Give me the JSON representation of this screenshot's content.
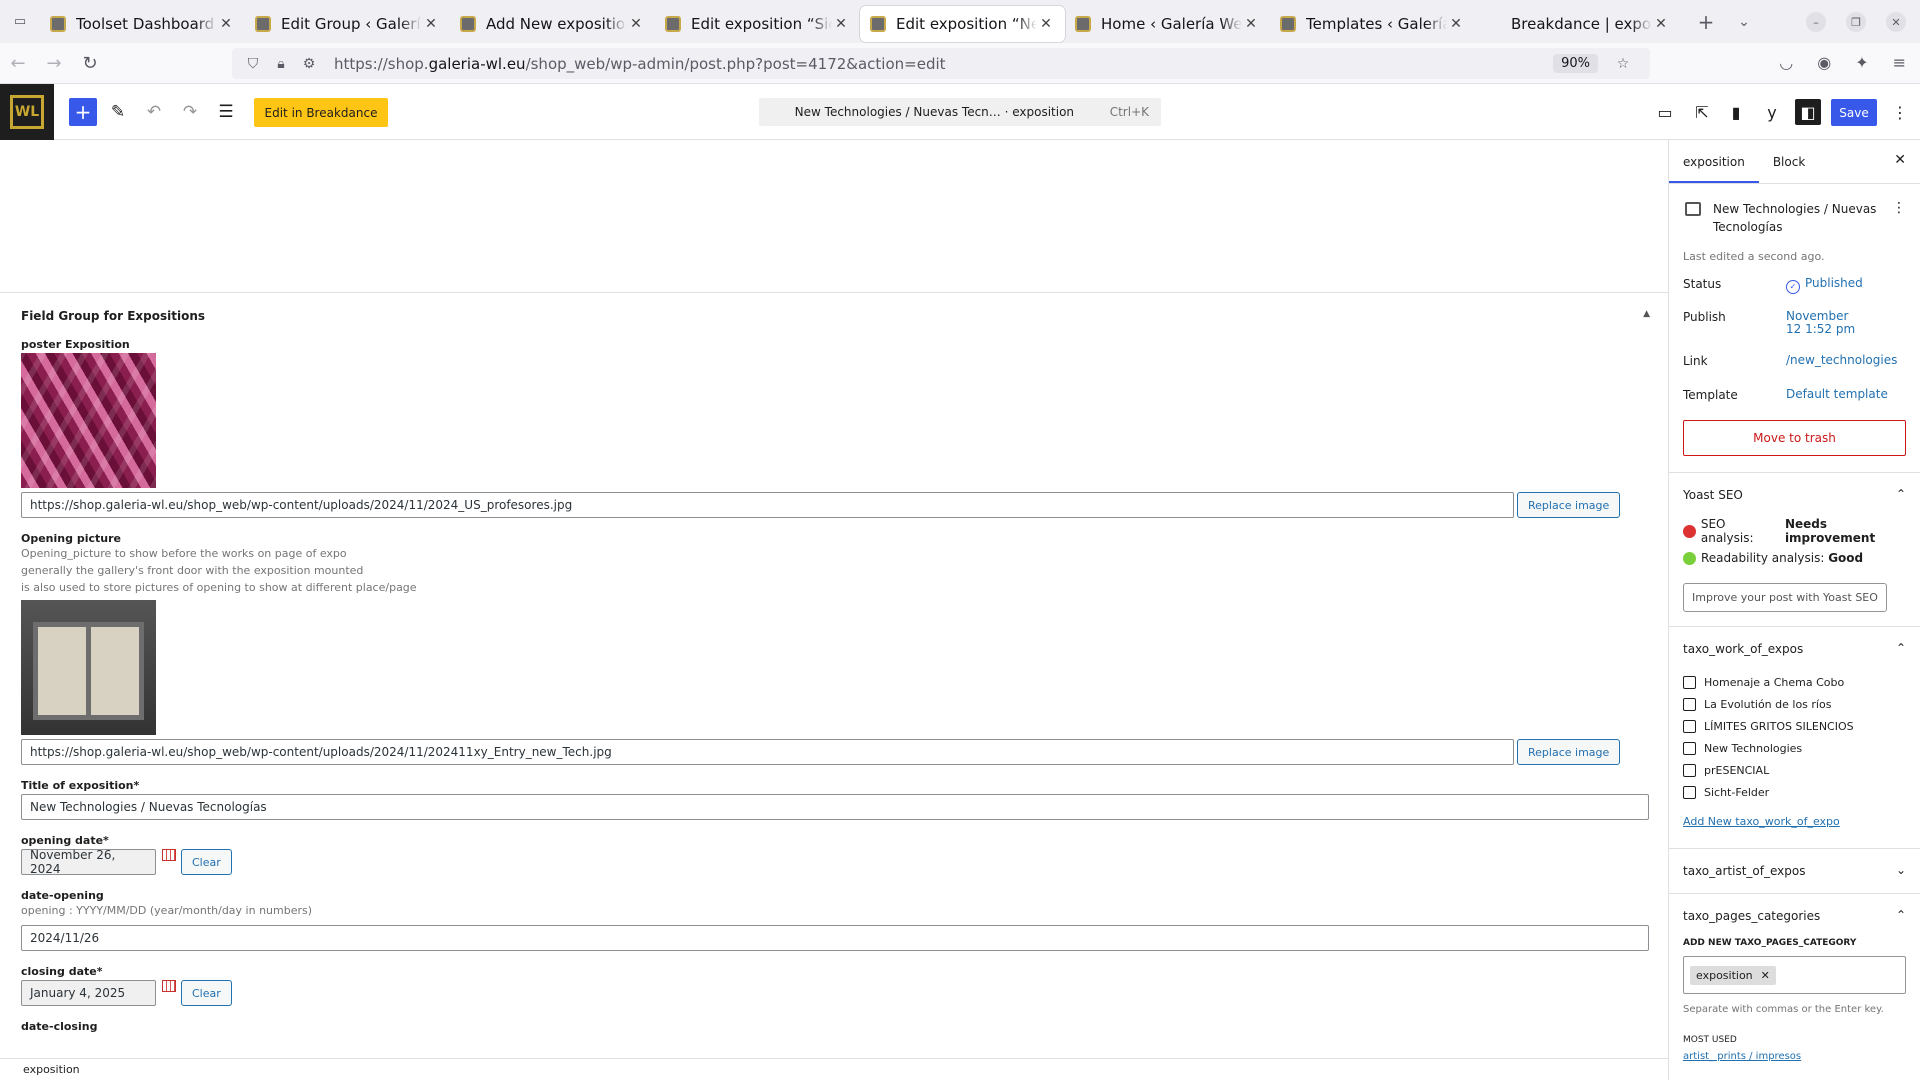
{
  "browser": {
    "tabs": [
      {
        "title": "Toolset Dashboard ‹ Galería Weber",
        "active": false,
        "favicon": true
      },
      {
        "title": "Edit Group ‹ Galería Weber",
        "active": false,
        "favicon": true
      },
      {
        "title": "Add New exposition ‹ Galería",
        "active": false,
        "favicon": true
      },
      {
        "title": "Edit exposition “Sicht-Felder”",
        "active": false,
        "favicon": true
      },
      {
        "title": "Edit exposition “New Technologies",
        "active": true,
        "favicon": true
      },
      {
        "title": "Home ‹ Galería Weber-Lutkow",
        "active": false,
        "favicon": true
      },
      {
        "title": "Templates ‹ Galería Weber",
        "active": false,
        "favicon": true
      },
      {
        "title": "Breakdance | exposition",
        "active": false,
        "favicon": false
      }
    ],
    "url_prefix": "https://shop.",
    "url_domain": "galeria-wl.eu",
    "url_path": "/shop_web/wp-admin/post.php?post=4172&action=edit",
    "zoom": "90%"
  },
  "editor": {
    "logo_text": "WL",
    "breakdance_label": "Edit in Breakdance",
    "command_title": "New Technologies / Nuevas Tecn… · exposition",
    "command_shortcut": "Ctrl+K",
    "save_label": "Save"
  },
  "fieldgroup": {
    "title": "Field Group for Expositions",
    "poster_label": "poster Exposition",
    "poster_url": "https://shop.galeria-wl.eu/shop_web/wp-content/uploads/2024/11/2024_US_profesores.jpg",
    "replace_label": "Replace image",
    "opening_label": "Opening picture",
    "opening_desc": [
      "Opening_picture to show before the works on page of expo",
      "generally the gallery's front door with the exposition mounted",
      "is also used to store pictures of opening to show at different place/page"
    ],
    "opening_url": "https://shop.galeria-wl.eu/shop_web/wp-content/uploads/2024/11/202411xy_Entry_new_Tech.jpg",
    "title_label": "Title of exposition*",
    "title_value": "New Technologies / Nuevas Tecnologías",
    "opening_date_label": "opening date*",
    "opening_date_value": "November 26, 2024",
    "clear_label": "Clear",
    "date_opening_label": "date-opening",
    "date_opening_desc": "opening : YYYY/MM/DD (year/month/day in numbers)",
    "date_opening_value": "2024/11/26",
    "closing_date_label": "closing date*",
    "closing_date_value": "January 4, 2025",
    "date_closing_label": "date-closing"
  },
  "breadcrumb": "exposition",
  "sidebar": {
    "tab_post": "exposition",
    "tab_block": "Block",
    "post_title": "New Technologies / Nuevas Tecnologías",
    "last_edited": "Last edited a second ago.",
    "rows": {
      "status_k": "Status",
      "status_v": "Published",
      "publish_k": "Publish",
      "publish_v1": "November",
      "publish_v2": "12 1:52 pm",
      "link_k": "Link",
      "link_v": "/new_technologies",
      "template_k": "Template",
      "template_v": "Default template"
    },
    "trash_label": "Move to trash",
    "yoast": {
      "title": "Yoast SEO",
      "seo_label": "SEO analysis:",
      "seo_value": "Needs improvement",
      "read_label": "Readability analysis:",
      "read_value": "Good",
      "button": "Improve your post with Yoast SEO"
    },
    "taxo_work": {
      "title": "taxo_work_of_expos",
      "terms": [
        "Homenaje a Chema Cobo",
        "La Evolutión de los ríos",
        "LÍMITES GRITOS SILENCIOS",
        "New Technologies",
        "prESENCIAL",
        "Sicht-Felder"
      ],
      "add_new": "Add New taxo_work_of_expo"
    },
    "taxo_artist": {
      "title": "taxo_artist_of_expos"
    },
    "taxo_pages": {
      "title": "taxo_pages_categories",
      "add_label": "Add New taxo_pages_category",
      "token": "exposition",
      "help": "Separate with commas or the Enter key.",
      "most_used": "Most used",
      "most_links": "artist_ prints / impresos"
    }
  },
  "colors": {
    "wp_blue": "#3858e9",
    "breakdance_yellow": "#ffc514",
    "trash_red": "#cc1818",
    "link_blue": "#2271b1"
  }
}
